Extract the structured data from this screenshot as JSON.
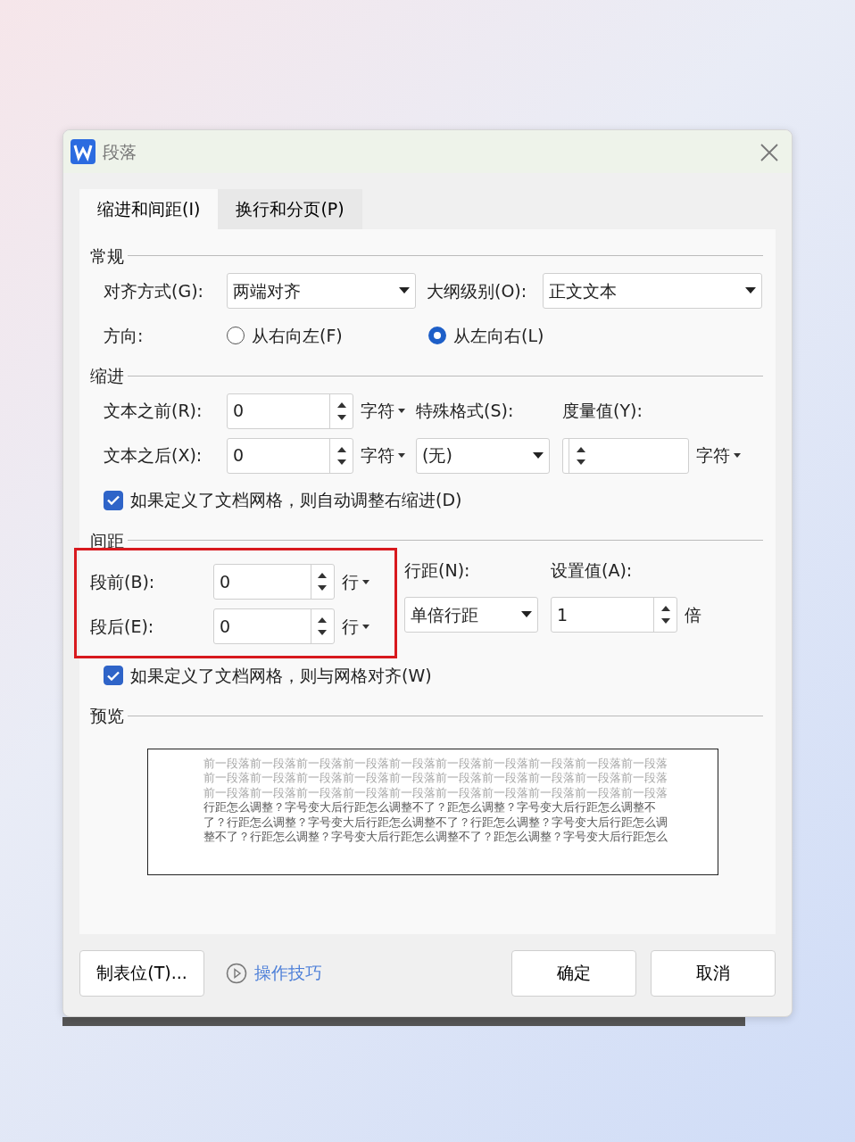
{
  "window": {
    "title": "段落"
  },
  "tabs": [
    {
      "label": "缩进和间距(I)",
      "selected": true
    },
    {
      "label": "换行和分页(P)",
      "selected": false
    }
  ],
  "general": {
    "heading": "常规",
    "alignment": {
      "label": "对齐方式(G):",
      "value": "两端对齐"
    },
    "outline_level": {
      "label": "大纲级别(O):",
      "value": "正文文本"
    },
    "direction": {
      "label": "方向:",
      "options": [
        {
          "label": "从右向左(F)",
          "selected": false
        },
        {
          "label": "从左向右(L)",
          "selected": true
        }
      ]
    }
  },
  "indent": {
    "heading": "缩进",
    "before_text": {
      "label": "文本之前(R):",
      "value": "0",
      "unit": "字符"
    },
    "after_text": {
      "label": "文本之后(X):",
      "value": "0",
      "unit": "字符"
    },
    "special": {
      "label": "特殊格式(S):",
      "value": "(无)"
    },
    "measure": {
      "label": "度量值(Y):",
      "unit": "字符"
    },
    "auto_adjust": {
      "label": "如果定义了文档网格，则自动调整右缩进(D)",
      "checked": true
    }
  },
  "spacing": {
    "heading": "间距",
    "highlight": true,
    "before": {
      "label": "段前(B):",
      "value": "0",
      "unit": "行"
    },
    "after": {
      "label": "段后(E):",
      "value": "0",
      "unit": "行"
    },
    "line_spacing": {
      "label": "行距(N):",
      "value": "单倍行距"
    },
    "set_value": {
      "label": "设置值(A):",
      "value": "1",
      "unit": "倍"
    },
    "snap_to_grid": {
      "label": "如果定义了文档网格，则与网格对齐(W)",
      "checked": true
    }
  },
  "preview": {
    "heading": "预览",
    "previous_lines": [
      "前一段落前一段落前一段落前一段落前一段落前一段落前一段落前一段落前一段落前一段落",
      "前一段落前一段落前一段落前一段落前一段落前一段落前一段落前一段落前一段落前一段落",
      "前一段落前一段落前一段落前一段落前一段落前一段落前一段落前一段落前一段落前一段落"
    ],
    "sample_lines": [
      "行距怎么调整？字号变大后行距怎么调整不了？距怎么调整？字号变大后行距怎么调整不",
      "了？行距怎么调整？字号变大后行距怎么调整不了？行距怎么调整？字号变大后行距怎么调",
      "整不了？行距怎么调整？字号变大后行距怎么调整不了？距怎么调整？字号变大后行距怎么"
    ]
  },
  "footer": {
    "tabs_button": "制表位(T)...",
    "tips_link": "操作技巧",
    "ok_button": "确定",
    "cancel_button": "取消"
  }
}
